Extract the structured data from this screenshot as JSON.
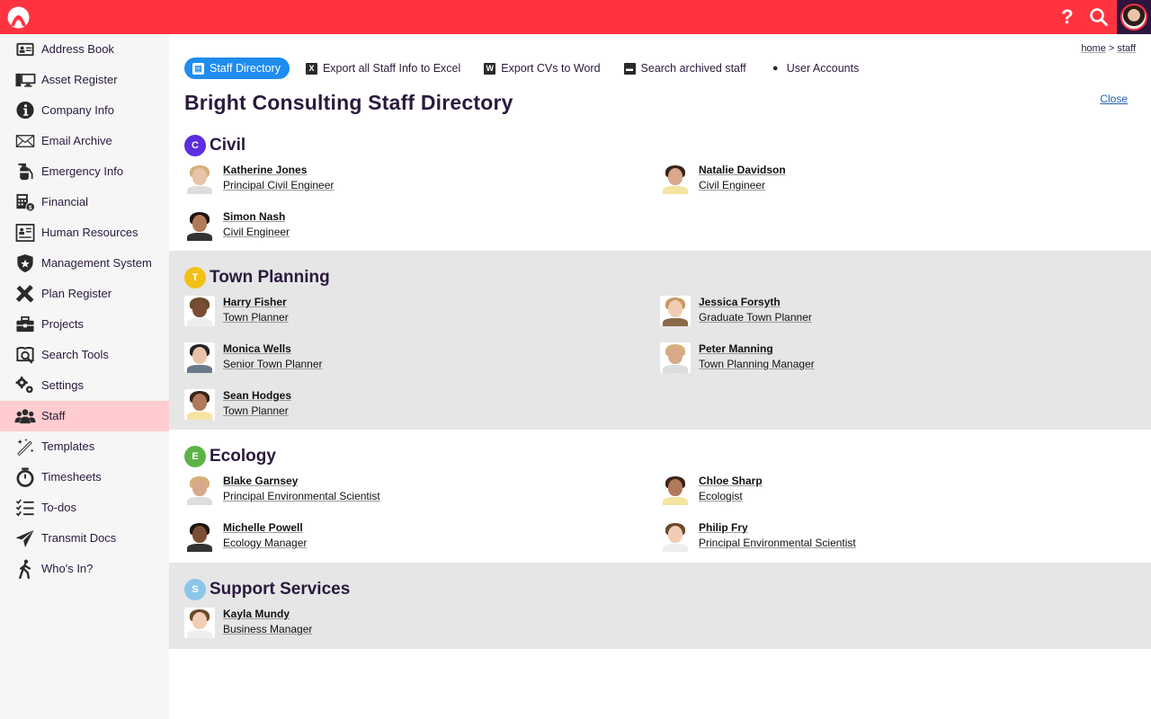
{
  "topbar": {
    "logo": "app-logo",
    "help_label": "?",
    "search_icon": "search-icon",
    "accent_color": "#ff333f"
  },
  "sidebar": {
    "items": [
      {
        "label": "Address Book",
        "icon": "address-card-icon"
      },
      {
        "label": "Asset Register",
        "icon": "computer-icon"
      },
      {
        "label": "Company Info",
        "icon": "info-icon"
      },
      {
        "label": "Email Archive",
        "icon": "envelope-icon"
      },
      {
        "label": "Emergency Info",
        "icon": "fire-extinguisher-icon"
      },
      {
        "label": "Financial",
        "icon": "calculator-icon"
      },
      {
        "label": "Human Resources",
        "icon": "id-card-icon"
      },
      {
        "label": "Management System",
        "icon": "shield-star-icon"
      },
      {
        "label": "Plan Register",
        "icon": "ruler-pencil-icon"
      },
      {
        "label": "Projects",
        "icon": "briefcase-icon"
      },
      {
        "label": "Search Tools",
        "icon": "search-book-icon"
      },
      {
        "label": "Settings",
        "icon": "gears-icon"
      },
      {
        "label": "Staff",
        "icon": "users-icon",
        "active": true
      },
      {
        "label": "Templates",
        "icon": "magic-wand-icon"
      },
      {
        "label": "Timesheets",
        "icon": "stopwatch-icon"
      },
      {
        "label": "To-dos",
        "icon": "checklist-icon"
      },
      {
        "label": "Transmit Docs",
        "icon": "paper-plane-icon"
      },
      {
        "label": "Who's In?",
        "icon": "walking-person-icon"
      }
    ]
  },
  "breadcrumb": {
    "home": "home",
    "separator": ">",
    "current": "staff"
  },
  "toolbar": {
    "items": [
      {
        "label": "Staff Directory",
        "icon_glyph": "▤",
        "active": true
      },
      {
        "label": "Export all Staff Info to Excel",
        "icon_glyph": "X"
      },
      {
        "label": "Export CVs to Word",
        "icon_glyph": "W"
      },
      {
        "label": "Search archived staff",
        "icon_glyph": "▬"
      },
      {
        "label": "User Accounts",
        "icon_glyph": "●"
      }
    ]
  },
  "page": {
    "title": "Bright Consulting Staff Directory",
    "close_label": "Close"
  },
  "sections": [
    {
      "letter": "C",
      "title": "Civil",
      "color": "#5b2ee0",
      "people": [
        {
          "name": "Katherine Jones",
          "role": "Principal Civil Engineer"
        },
        {
          "name": "Natalie Davidson",
          "role": "Civil Engineer"
        },
        {
          "name": "Simon Nash",
          "role": "Civil Engineer"
        }
      ]
    },
    {
      "letter": "T",
      "title": "Town Planning",
      "color": "#f2c018",
      "people": [
        {
          "name": "Harry Fisher",
          "role": "Town Planner"
        },
        {
          "name": "Jessica Forsyth",
          "role": "Graduate Town Planner"
        },
        {
          "name": "Monica Wells",
          "role": "Senior Town Planner"
        },
        {
          "name": "Peter Manning",
          "role": "Town Planning Manager"
        },
        {
          "name": "Sean Hodges",
          "role": "Town Planner"
        }
      ]
    },
    {
      "letter": "E",
      "title": "Ecology",
      "color": "#5cb346",
      "people": [
        {
          "name": "Blake Garnsey",
          "role": "Principal Environmental Scientist"
        },
        {
          "name": "Chloe Sharp",
          "role": "Ecologist"
        },
        {
          "name": "Michelle Powell",
          "role": "Ecology Manager"
        },
        {
          "name": "Philip Fry",
          "role": "Principal Environmental Scientist"
        }
      ]
    },
    {
      "letter": "S",
      "title": "Support Services",
      "color": "#8cc6ea",
      "people": [
        {
          "name": "Kayla Mundy",
          "role": "Business Manager"
        }
      ]
    }
  ]
}
